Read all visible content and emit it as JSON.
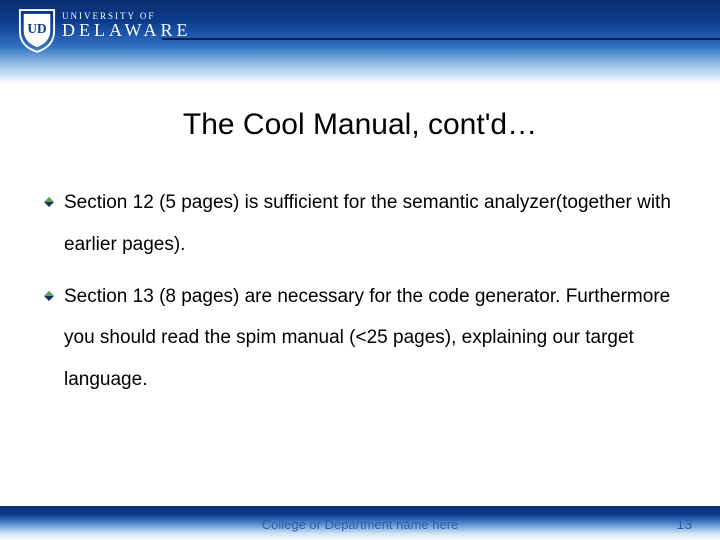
{
  "logo": {
    "small": "UNIVERSITY OF",
    "big": "DELAWARE"
  },
  "title": "The Cool Manual, cont'd…",
  "bullets": [
    "Section 12 (5 pages) is sufficient for the semantic analyzer(together with earlier pages).",
    "Section 13 (8 pages) are necessary for the code generator. Furthermore you should read the spim manual (<25 pages), explaining our target language."
  ],
  "footer": {
    "dept": "College or Department name here",
    "page": "13"
  }
}
